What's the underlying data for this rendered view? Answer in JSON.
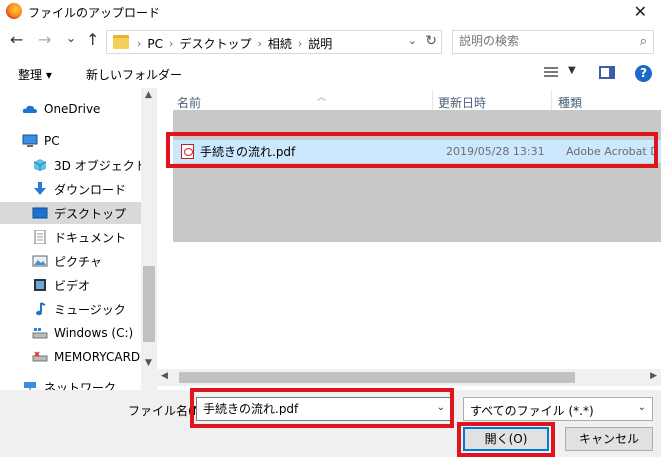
{
  "window": {
    "title": "ファイルのアップロード",
    "close_glyph": "✕"
  },
  "nav": {
    "back": "←",
    "forward": "→",
    "recent": "⌄",
    "up": "↑",
    "breadcrumbs": [
      "PC",
      "デスクトップ",
      "相続",
      "説明"
    ],
    "breadcrumb_separator": "›",
    "search_placeholder": "説明の検索"
  },
  "toolbar": {
    "organize": "整理 ▾",
    "new_folder": "新しいフォルダー",
    "help": "?"
  },
  "sidebar": {
    "items": [
      {
        "label": "OneDrive",
        "icon": "cloud-icon"
      },
      {
        "label": "PC",
        "icon": "computer-icon"
      },
      {
        "label": "3D オブジェクト",
        "icon": "cube-icon"
      },
      {
        "label": "ダウンロード",
        "icon": "download-icon"
      },
      {
        "label": "デスクトップ",
        "icon": "desktop-icon",
        "selected": true
      },
      {
        "label": "ドキュメント",
        "icon": "document-icon"
      },
      {
        "label": "ピクチャ",
        "icon": "picture-icon"
      },
      {
        "label": "ビデオ",
        "icon": "video-icon"
      },
      {
        "label": "ミュージック",
        "icon": "music-icon"
      },
      {
        "label": "Windows (C:)",
        "icon": "drive-icon"
      },
      {
        "label": "MEMORYCARD (",
        "icon": "memory-card-icon"
      },
      {
        "label": "ネットワーク",
        "icon": "network-icon"
      }
    ]
  },
  "file_list": {
    "columns": [
      "名前",
      "更新日時",
      "種類"
    ],
    "files": [
      {
        "name": "手続きの流れ.pdf",
        "modified": "2019/05/28 13:31",
        "type": "Adobe Acrobat D"
      }
    ]
  },
  "bottom": {
    "filename_label": "ファイル名(N):",
    "filename_value": "手続きの流れ.pdf",
    "filter_value": "すべてのファイル (*.*)",
    "open_button": "開く(O)",
    "cancel_button": "キャンセル"
  },
  "colors": {
    "highlight_red": "#e0141c",
    "selection_blue": "#cce8ff",
    "accent_blue": "#0078d7"
  }
}
